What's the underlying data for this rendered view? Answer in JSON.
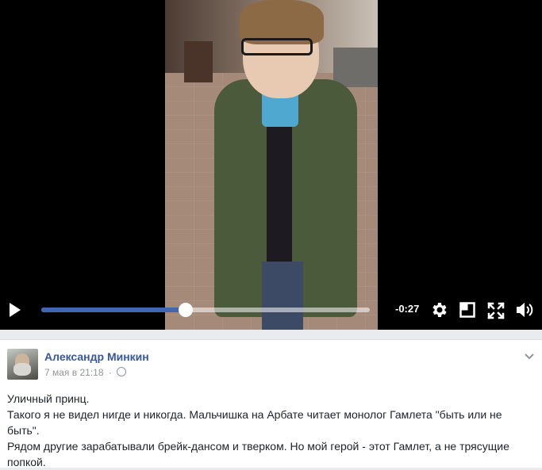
{
  "video": {
    "time_remaining": "-0:27",
    "progress_fraction": 0.44,
    "controls": {
      "play": "play-icon",
      "settings": "gear-icon",
      "popout": "popout-icon",
      "fullscreen": "fullscreen-icon",
      "volume": "volume-icon"
    },
    "accent_color": "#4267b2"
  },
  "post": {
    "author": "Александр Минкин",
    "timestamp": "7 мая в 21:18",
    "separator": "·",
    "privacy_icon": "globe-icon",
    "menu_icon": "chevron-down-icon",
    "lines": [
      "Уличный принц.",
      "Такого я не видел нигде и никогда. Мальчишка на Арбате читает монолог Гамлета \"быть или не быть\".",
      "Рядом другие зарабатывали брейк-дансом и тверком. Но мой герой - этот Гамлет, а не трясущие попкой."
    ],
    "author_color": "#365899"
  }
}
